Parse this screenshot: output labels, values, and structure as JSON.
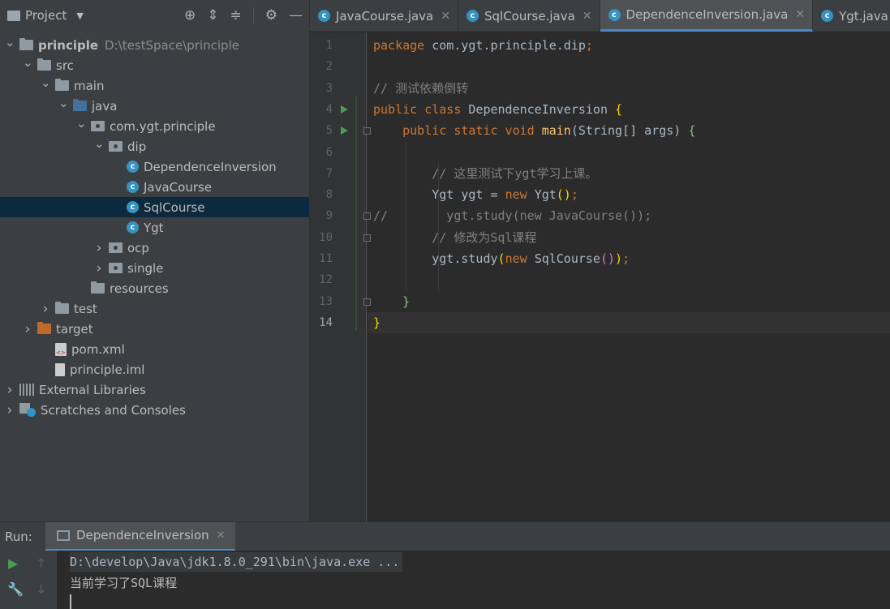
{
  "project": {
    "title": "Project",
    "tree": [
      {
        "label": "principle",
        "extra": "D:\\testSpace\\principle",
        "icon": "module-folder-icon",
        "indent": 0,
        "expanded": true,
        "bold": true
      },
      {
        "label": "src",
        "icon": "folder-icon",
        "indent": 1,
        "expanded": true
      },
      {
        "label": "main",
        "icon": "folder-icon",
        "indent": 2,
        "expanded": true
      },
      {
        "label": "java",
        "icon": "source-folder-icon",
        "indent": 3,
        "expanded": true
      },
      {
        "label": "com.ygt.principle",
        "icon": "package-icon",
        "indent": 4,
        "expanded": true
      },
      {
        "label": "dip",
        "icon": "package-icon",
        "indent": 5,
        "expanded": true
      },
      {
        "label": "DependenceInversion",
        "icon": "runnable-class-icon",
        "indent": 6
      },
      {
        "label": "JavaCourse",
        "icon": "class-icon",
        "indent": 6
      },
      {
        "label": "SqlCourse",
        "icon": "class-icon",
        "indent": 6,
        "selected": true
      },
      {
        "label": "Ygt",
        "icon": "class-icon",
        "indent": 6
      },
      {
        "label": "ocp",
        "icon": "package-icon",
        "indent": 5,
        "expanded": false
      },
      {
        "label": "single",
        "icon": "package-icon",
        "indent": 5,
        "expanded": false
      },
      {
        "label": "resources",
        "icon": "resources-folder-icon",
        "indent": 4
      },
      {
        "label": "test",
        "icon": "folder-icon",
        "indent": 2,
        "expanded": false
      },
      {
        "label": "target",
        "icon": "excluded-folder-icon",
        "indent": 1,
        "expanded": false
      },
      {
        "label": "pom.xml",
        "icon": "maven-xml-icon",
        "indent": 2
      },
      {
        "label": "principle.iml",
        "icon": "iml-file-icon",
        "indent": 2
      },
      {
        "label": "External Libraries",
        "icon": "libraries-icon",
        "indent": 0,
        "expanded": false
      },
      {
        "label": "Scratches and Consoles",
        "icon": "scratches-icon",
        "indent": 0,
        "expanded": false
      }
    ]
  },
  "tabs": [
    {
      "label": "JavaCourse.java",
      "active": false
    },
    {
      "label": "SqlCourse.java",
      "active": false
    },
    {
      "label": "DependenceInversion.java",
      "active": true
    },
    {
      "label": "Ygt.java",
      "active": false
    }
  ],
  "editor": {
    "line_numbers": [
      "1",
      "2",
      "3",
      "4",
      "5",
      "6",
      "7",
      "8",
      "9",
      "10",
      "11",
      "12",
      "13",
      "14"
    ],
    "lines": [
      [
        {
          "t": "package ",
          "c": "kw"
        },
        {
          "t": "com.ygt.principle.dip",
          "c": ""
        },
        {
          "t": ";",
          "c": "kw"
        }
      ],
      [],
      [
        {
          "t": "// 测试依赖倒转",
          "c": "cm"
        }
      ],
      [
        {
          "t": "public class ",
          "c": "kw"
        },
        {
          "t": "DependenceInversion ",
          "c": ""
        },
        {
          "t": "{",
          "c": "br"
        }
      ],
      [
        {
          "t": "    public static void ",
          "c": "kw"
        },
        {
          "t": "main",
          "c": "fn"
        },
        {
          "t": "(String[] args) ",
          "c": ""
        },
        {
          "t": "{",
          "c": "brg"
        }
      ],
      [],
      [
        {
          "t": "        // 这里测试下ygt学习上课。",
          "c": "cm"
        }
      ],
      [
        {
          "t": "        Ygt ygt = ",
          "c": ""
        },
        {
          "t": "new ",
          "c": "kw"
        },
        {
          "t": "Ygt",
          "c": ""
        },
        {
          "t": "()",
          "c": "br"
        },
        {
          "t": ";",
          "c": "kw"
        }
      ],
      [
        {
          "t": "//        ygt.study(new JavaCourse());",
          "c": "cm"
        }
      ],
      [
        {
          "t": "        // 修改为Sql课程",
          "c": "cm"
        }
      ],
      [
        {
          "t": "        ygt.study",
          "c": ""
        },
        {
          "t": "(",
          "c": "br"
        },
        {
          "t": "new ",
          "c": "kw"
        },
        {
          "t": "SqlCourse",
          "c": ""
        },
        {
          "t": "()",
          "c": "br2"
        },
        {
          "t": ")",
          "c": "br"
        },
        {
          "t": ";",
          "c": "kw"
        }
      ],
      [],
      [
        {
          "t": "    }",
          "c": "brg"
        }
      ],
      [
        {
          "t": "}",
          "c": "br"
        }
      ]
    ]
  },
  "run": {
    "label": "Run:",
    "tab_label": "DependenceInversion",
    "console": [
      "D:\\develop\\Java\\jdk1.8.0_291\\bin\\java.exe ...",
      "当前学习了SQL课程"
    ]
  }
}
